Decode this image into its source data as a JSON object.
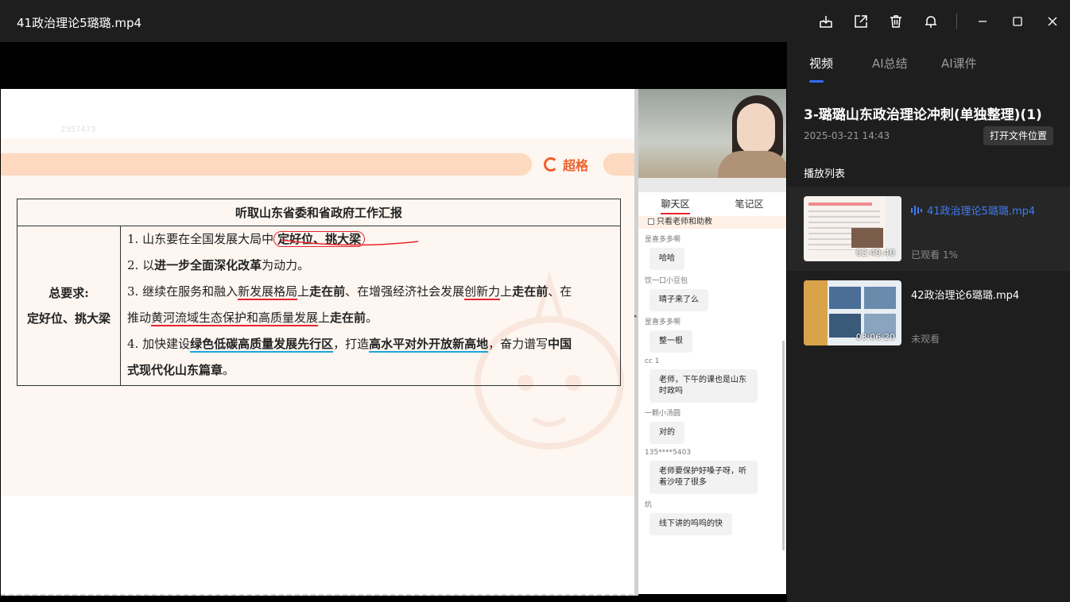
{
  "window": {
    "title": "41政治理论5璐璐.mp4",
    "icons": [
      "download-icon",
      "share-icon",
      "delete-icon",
      "pin-icon",
      "minimize-icon",
      "maximize-icon",
      "close-icon"
    ]
  },
  "slide": {
    "watermark_number": "2357473",
    "logo_text": "超格",
    "table_header": "听取山东省委和省政府工作汇报",
    "left_title": "总要求:",
    "left_subtitle": "定好位、挑大梁",
    "items": {
      "i1_prefix": "1. 山东要在全国发展大局中",
      "i1_bold": "定好位、挑大梁",
      "i2_prefix": "2. 以",
      "i2_bold": "进一步全面深化改革",
      "i2_suffix": "为动力。",
      "i3_a": "3. 继续在服务和融入",
      "i3_b": "新发展格局",
      "i3_c": "上",
      "i3_d": "走在前",
      "i3_e": "、在增强经济社会发展",
      "i3_f": "创新力",
      "i3_g": "上",
      "i3_h": "走在前",
      "i3_i": "、在",
      "i3_j": "推动",
      "i3_k": "黄河流域生态保护和高质量发展",
      "i3_l": "上",
      "i3_m": "走在前",
      "i3_n": "。",
      "i4_a": "4. 加快建设",
      "i4_b": "绿色低碳高质量发展先行区",
      "i4_c": "，打造",
      "i4_d": "高水平对外开放新高地",
      "i4_e": "，奋力谱写",
      "i4_f": "中国",
      "i4_g": "式现代化山东篇章",
      "i4_h": "。"
    }
  },
  "chat": {
    "tabs": [
      "聊天区",
      "笔记区"
    ],
    "active_tab": "聊天区",
    "filter_label": "只看老师和助教",
    "messages": [
      {
        "nick": "昰喜多多啊",
        "text": "哈哈"
      },
      {
        "nick": "饮一口小豆包",
        "text": "晴子来了么"
      },
      {
        "nick": "昰喜多多啊",
        "text": "整一根"
      },
      {
        "nick": "cc 1",
        "text": "老师，下午的课也是山东时政吗"
      },
      {
        "nick": "一颗小汤圆",
        "text": "对的"
      },
      {
        "nick": "135****5403",
        "text": "老师要保护好嗓子呀，听着沙哑了很多"
      },
      {
        "nick": "炕",
        "text": "线下讲的呜呜的快"
      }
    ]
  },
  "sidebar": {
    "tabs": [
      "视频",
      "AI总结",
      "AI课件"
    ],
    "active_tab": "视频",
    "course_title": "3-璐璐山东政治理论冲刺(单独整理)(1)",
    "course_date": "2025-03-21 14:43",
    "open_location_label": "打开文件位置",
    "playlist_label": "播放列表",
    "playlist": [
      {
        "name": "41政治理论5璐璐.mp4",
        "duration": "02:49:40",
        "status": "已观看 1%",
        "playing": true
      },
      {
        "name": "42政治理论6璐璐.mp4",
        "duration": "03:06:20",
        "status": "未观看",
        "playing": false
      }
    ]
  },
  "colors": {
    "accent_blue": "#2f6df6",
    "annotation_red": "#e8242d",
    "annotation_blue": "#1aa6d8",
    "banner_orange": "#fcd9bf",
    "logo_orange": "#f0602a"
  }
}
